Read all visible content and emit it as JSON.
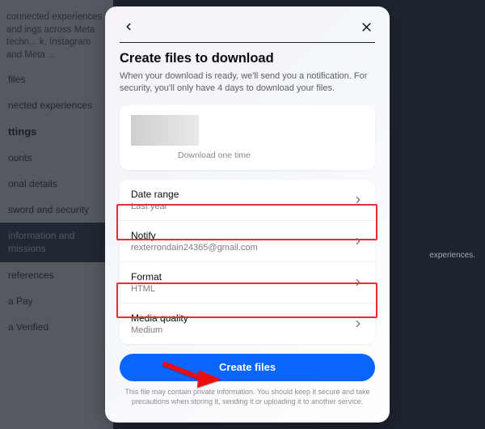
{
  "background": {
    "intro": "connected experiences and ings across Meta techn... k, Instagram and Meta ...",
    "items": [
      "files",
      "nected experiences"
    ],
    "heading": "ttings",
    "items2": [
      "ounts",
      "onal details",
      "sword and security"
    ],
    "selected": "information and missions",
    "items3": [
      "references",
      "a Pay",
      "a Verified"
    ],
    "right_text": "experiences."
  },
  "header": {
    "back_icon": "back",
    "close_icon": "close"
  },
  "title": "Create files to download",
  "subtitle": "When your download is ready, we'll send you a notification. For security, you'll only have 4 days to download your files.",
  "preview": {
    "caption": "Download one time"
  },
  "options": [
    {
      "label": "Date range",
      "value": "Last year"
    },
    {
      "label": "Notify",
      "value": "rexterrondain24365@gmail.com"
    },
    {
      "label": "Format",
      "value": "HTML"
    },
    {
      "label": "Media quality",
      "value": "Medium"
    }
  ],
  "create_button": "Create files",
  "footer": "This file may contain private information. You should keep it secure and take precautions when storing it, sending it or uploading it to another service."
}
